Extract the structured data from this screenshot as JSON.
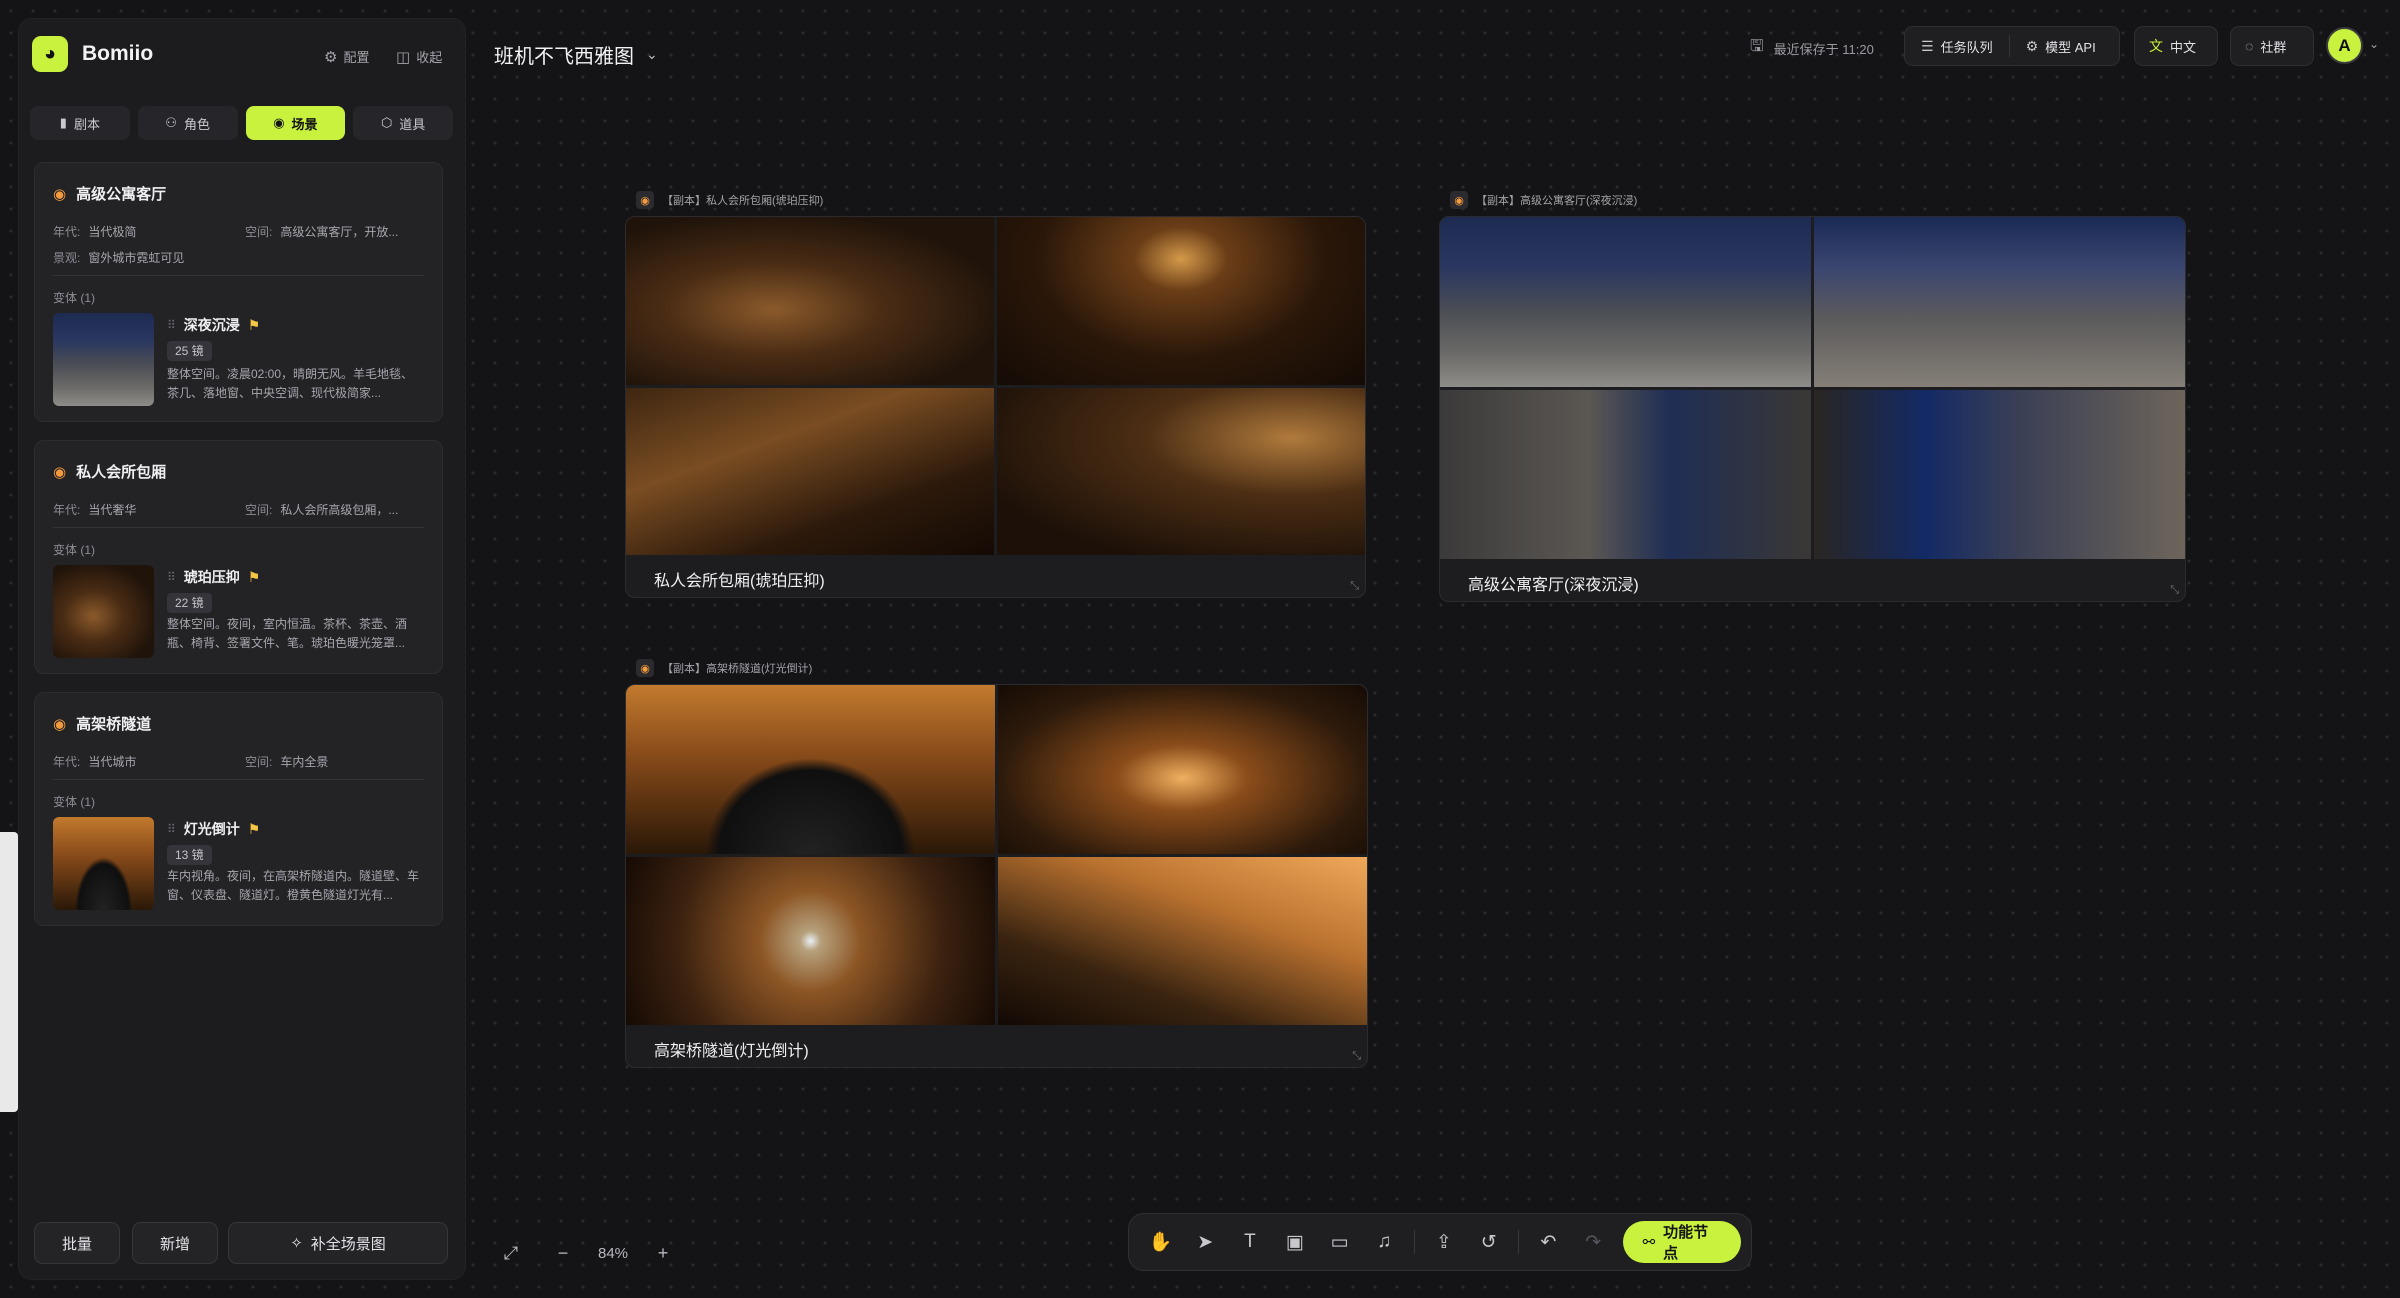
{
  "app": {
    "name": "Bomiio",
    "logo_icon": "bomiio-logo"
  },
  "sidebar": {
    "top_actions": [
      {
        "label": "配置",
        "icon": "gear-icon"
      },
      {
        "label": "收起",
        "icon": "collapse-icon"
      }
    ],
    "tabs": [
      {
        "label": "剧本",
        "icon": "script-icon",
        "active": false
      },
      {
        "label": "角色",
        "icon": "people-icon",
        "active": false
      },
      {
        "label": "场景",
        "icon": "location-pin-icon",
        "active": true
      },
      {
        "label": "道具",
        "icon": "box-icon",
        "active": false
      }
    ],
    "cards": [
      {
        "title": "高级公寓客厅",
        "era_label": "年代:",
        "era": "当代极简",
        "space_label": "空间:",
        "space": "高级公寓客厅，开放...",
        "extra_label": "景观:",
        "extra": "窗外城市霓虹可见",
        "variants_label": "变体 (1)",
        "variant": {
          "name": "深夜沉浸",
          "shots": "25 镜",
          "desc": "整体空间。凌晨02:00，晴朗无风。羊毛地毯、茶几、落地窗、中央空调、现代极简家..."
        }
      },
      {
        "title": "私人会所包厢",
        "era_label": "年代:",
        "era": "当代奢华",
        "space_label": "空间:",
        "space": "私人会所高级包厢，...",
        "variants_label": "变体 (1)",
        "variant": {
          "name": "琥珀压抑",
          "shots": "22 镜",
          "desc": "整体空间。夜间，室内恒温。茶杯、茶壶、酒瓶、椅背、签署文件、笔。琥珀色暖光笼罩..."
        }
      },
      {
        "title": "高架桥隧道",
        "era_label": "年代:",
        "era": "当代城市",
        "space_label": "空间:",
        "space": "车内全景",
        "variants_label": "变体 (1)",
        "variant": {
          "name": "灯光倒计",
          "shots": "13 镜",
          "desc": "车内视角。夜间，在高架桥隧道内。隧道壁、车窗、仪表盘、隧道灯。橙黄色隧道灯光有..."
        }
      }
    ],
    "bottom": {
      "batch": "批量",
      "add": "新增",
      "fill": "补全场景图"
    }
  },
  "header": {
    "project_title": "班机不飞西雅图",
    "save_status": "最近保存于 11:20",
    "task_queue": "任务队列",
    "model_api": "模型 API",
    "language": "中文",
    "community": "社群",
    "avatar_letter": "A"
  },
  "canvas": {
    "nodes": [
      {
        "label": "【副本】私人会所包厢(琥珀压抑)",
        "caption": "私人会所包厢(琥珀压抑)"
      },
      {
        "label": "【副本】高级公寓客厅(深夜沉浸)",
        "caption": "高级公寓客厅(深夜沉浸)"
      },
      {
        "label": "【副本】高架桥隧道(灯光倒计)",
        "caption": "高架桥隧道(灯光倒计)"
      }
    ]
  },
  "zoom": {
    "level": "84%"
  },
  "toolbar": {
    "tools": [
      "hand-icon",
      "pointer-icon",
      "text-icon",
      "image-icon",
      "video-icon",
      "music-icon",
      "upload-icon",
      "history-icon",
      "undo-icon",
      "redo-icon"
    ],
    "function_node": "功能节点"
  },
  "colors": {
    "accent": "#c8f23e",
    "pin": "#f39a3d",
    "flag": "#f6c744",
    "background": "#141416"
  }
}
